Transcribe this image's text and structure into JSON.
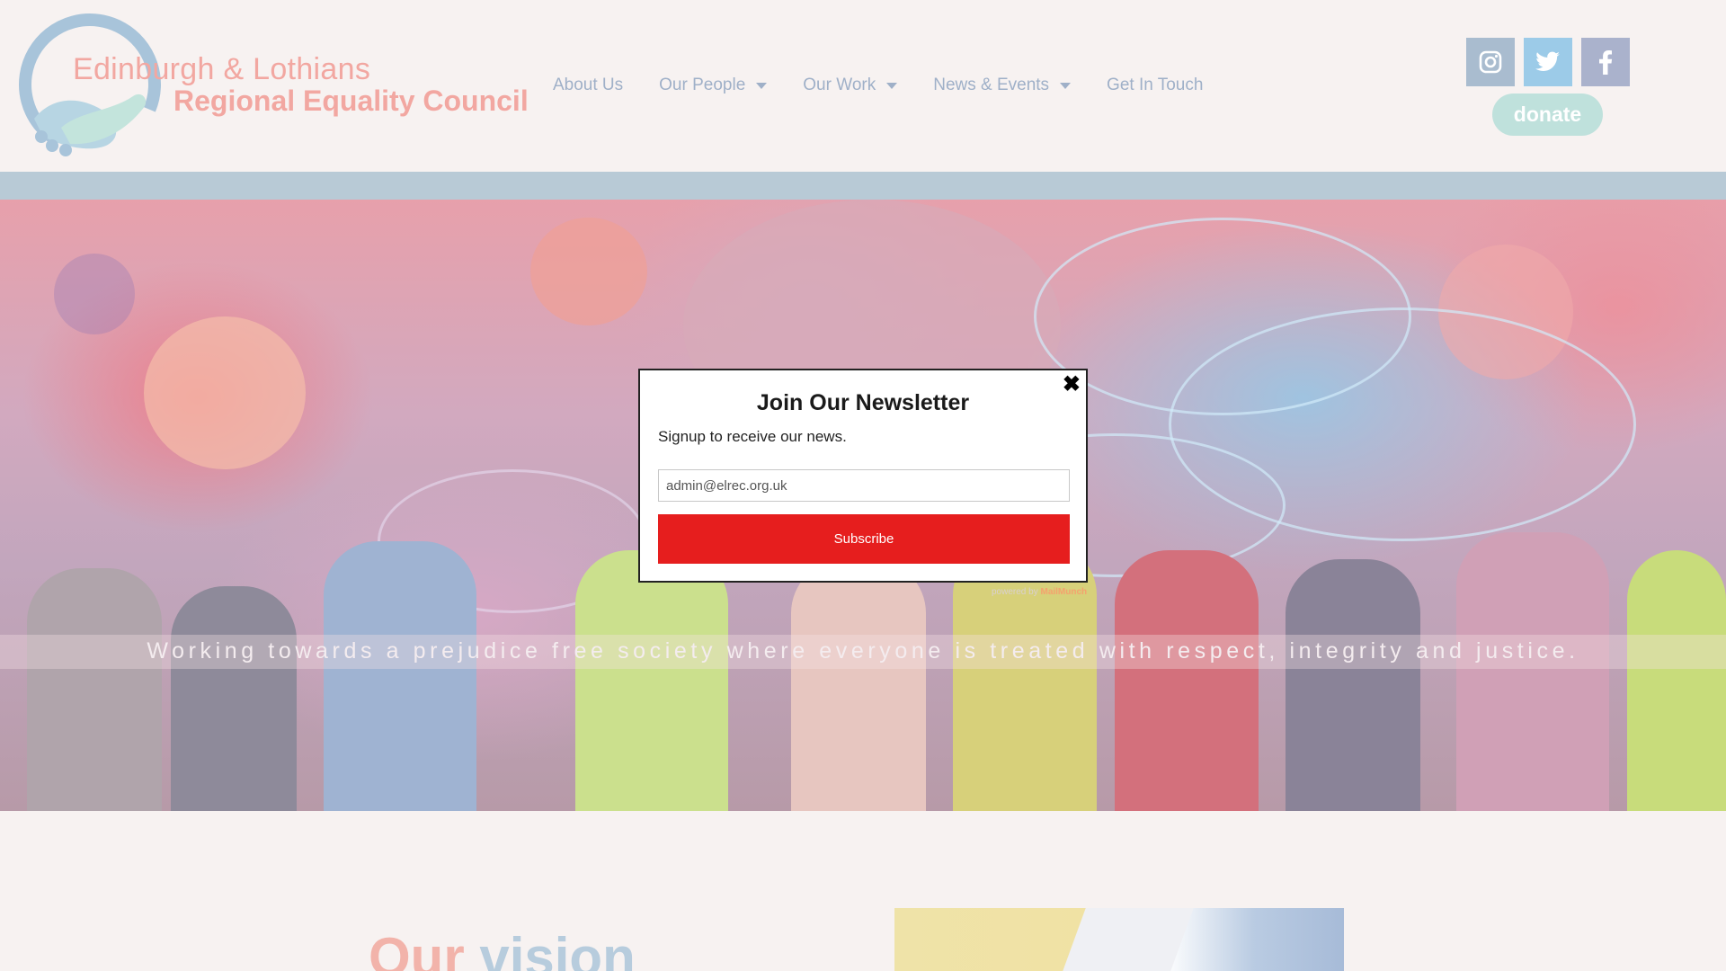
{
  "header": {
    "brand_line1": "Edinburgh & Lothians",
    "brand_line2": "Regional Equality Council",
    "nav": [
      {
        "label": "About Us",
        "dropdown": false
      },
      {
        "label": "Our People",
        "dropdown": true
      },
      {
        "label": "Our Work",
        "dropdown": true
      },
      {
        "label": "News & Events",
        "dropdown": true
      },
      {
        "label": "Get In Touch",
        "dropdown": false
      }
    ],
    "social": [
      {
        "icon": "instagram-icon",
        "color": "#a9bccf"
      },
      {
        "icon": "twitter-icon",
        "color": "#9ccbe8"
      },
      {
        "icon": "facebook-icon",
        "color": "#aab2cc"
      }
    ],
    "donate_label": "donate"
  },
  "hero": {
    "tagline": "Working towards a prejudice free society where everyone is treated with respect, integrity and justice."
  },
  "newsletter": {
    "title": "Join Our Newsletter",
    "subtitle": "Signup to receive our news.",
    "email_value": "admin@elrec.org.uk",
    "subscribe_label": "Subscribe",
    "close_glyph": "✖",
    "powered_by": "powered by",
    "provider": "MailMunch",
    "button_color": "#e61e1e"
  },
  "section": {
    "vision_word1": "Our",
    "vision_word2": "vision"
  }
}
